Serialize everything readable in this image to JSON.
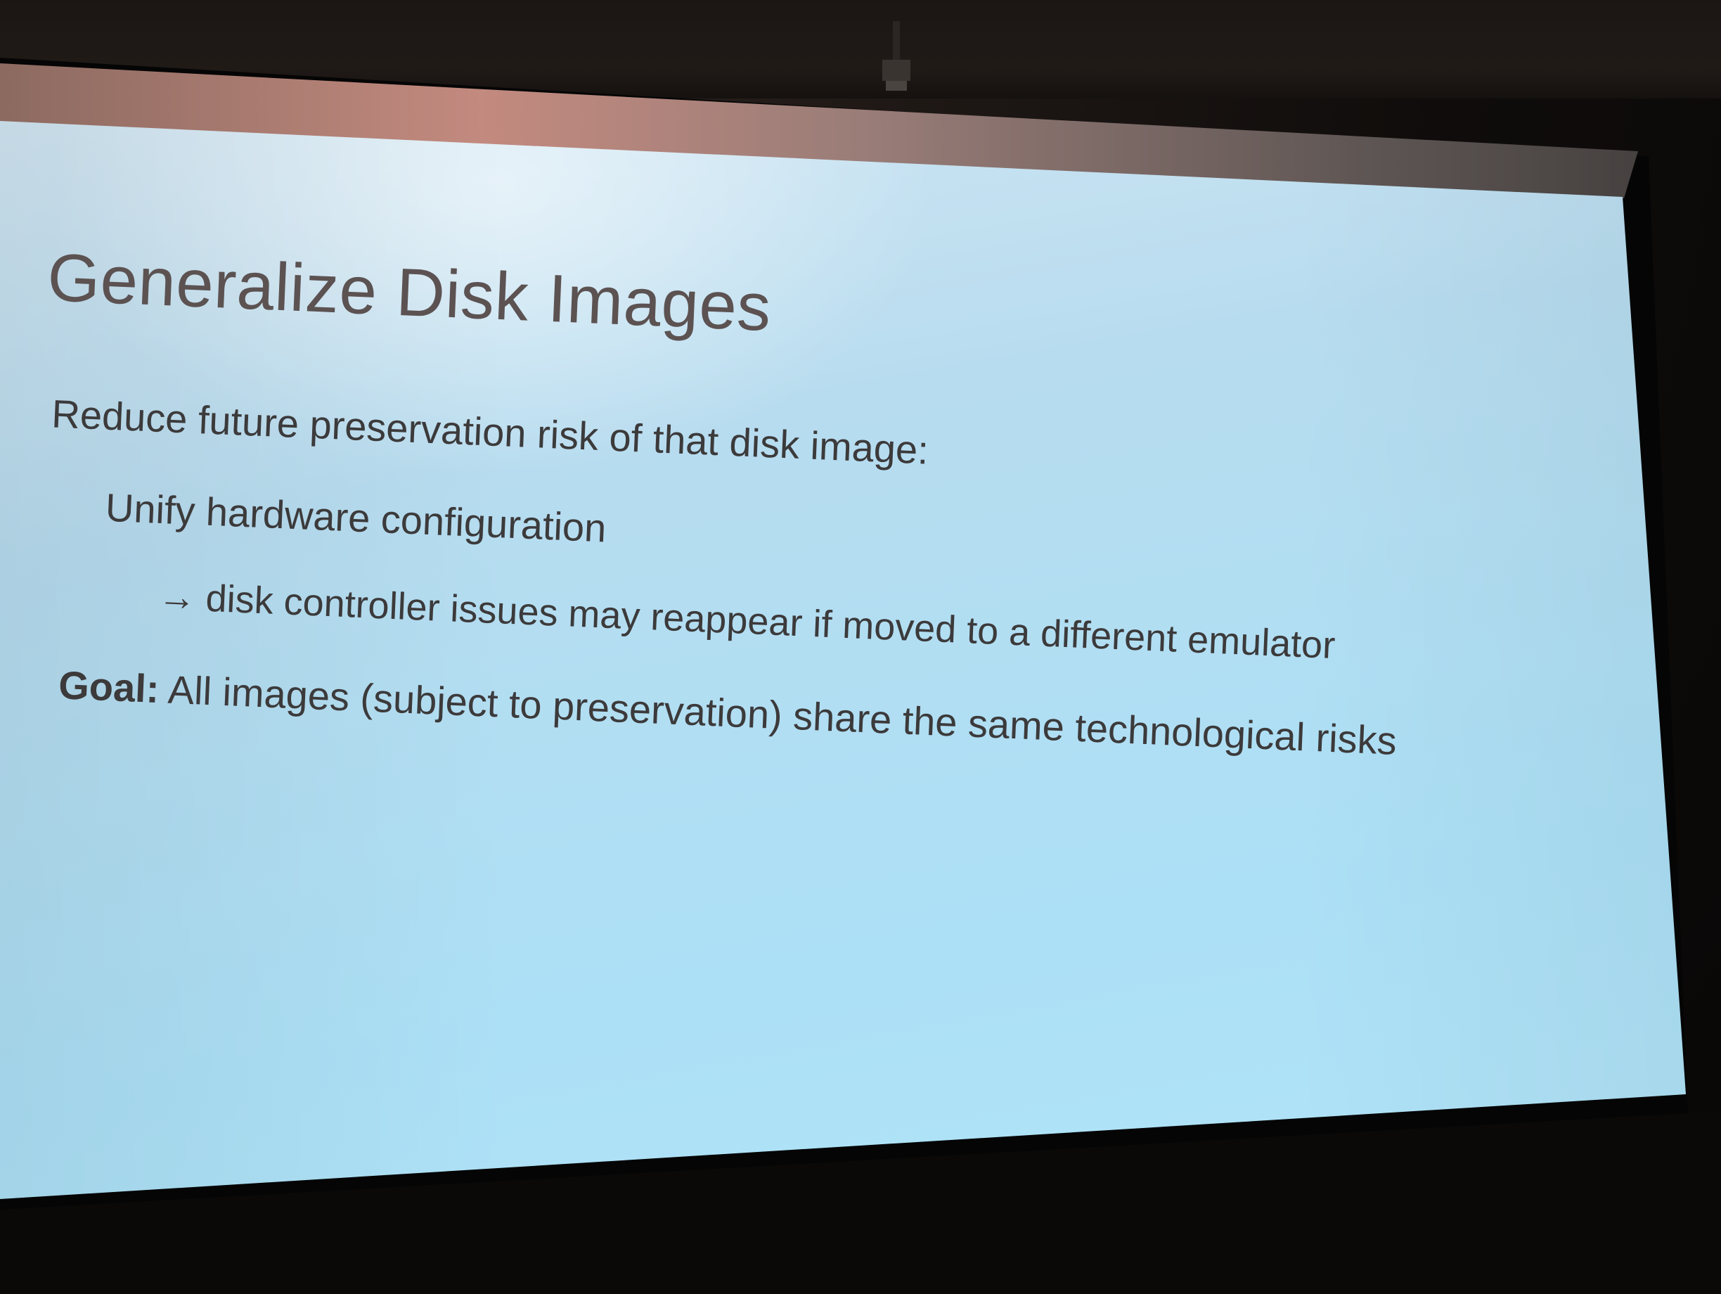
{
  "slide": {
    "title": "Generalize Disk Images",
    "lines": [
      {
        "text": "Reduce future preservation risk of that disk image:"
      },
      {
        "text": "Unify hardware configuration"
      },
      {
        "arrow": "→",
        "text": "disk controller issues may reappear if moved to a different emulator"
      },
      {
        "bold_prefix": "Goal:",
        "text": "All images (subject to preservation) share the same technological risks"
      }
    ]
  },
  "colors": {
    "screen_light": "#b7dcef",
    "screen_highlight": "#d9e9f4",
    "title_text": "#5c5252",
    "body_text": "#3c3a3b",
    "room_dark": "#0d0b0a"
  }
}
